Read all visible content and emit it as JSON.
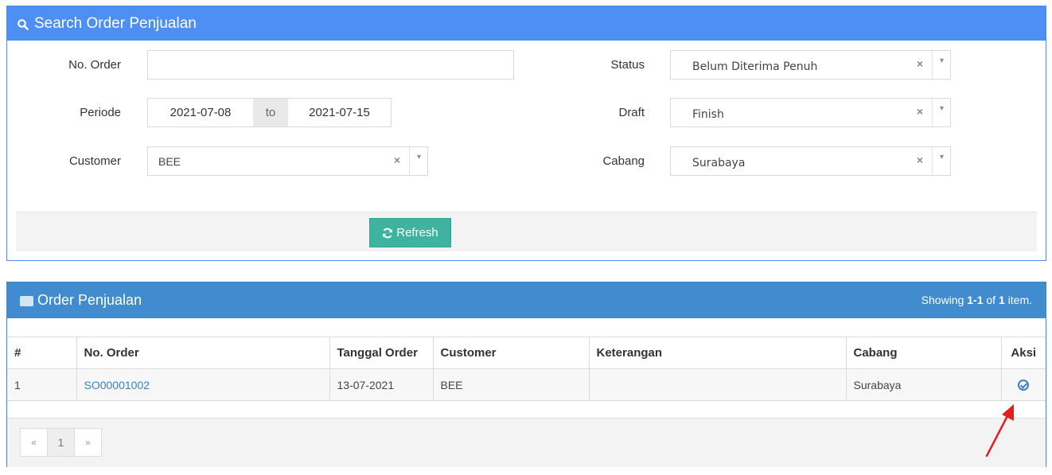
{
  "search": {
    "title": "Search Order Penjualan",
    "no_order_label": "No. Order",
    "no_order_value": "",
    "periode_label": "Periode",
    "periode_from": "2021-07-08",
    "periode_to_label": "to",
    "periode_to": "2021-07-15",
    "customer_label": "Customer",
    "customer_value": "BEE",
    "status_label": "Status",
    "status_value": "Belum Diterima Penuh",
    "draft_label": "Draft",
    "draft_value": "Finish",
    "cabang_label": "Cabang",
    "cabang_value": "Surabaya",
    "clear_glyph": "×",
    "arrow_glyph": "▾",
    "refresh_label": "Refresh",
    "refresh_icon": "refresh-icon"
  },
  "grid": {
    "title": "Order Penjualan",
    "summary_prefix": "Showing ",
    "summary_range": "1-1",
    "summary_of": " of ",
    "summary_total": "1",
    "summary_suffix": " item.",
    "columns": [
      "#",
      "No. Order",
      "Tanggal Order",
      "Customer",
      "Keterangan",
      "Cabang",
      "Aksi"
    ],
    "rows": [
      {
        "no": "1",
        "order": "SO00001002",
        "tanggal": "13-07-2021",
        "customer": "BEE",
        "keterangan": "",
        "cabang": "Surabaya",
        "aksi_icon": "check-circle-icon"
      }
    ],
    "pager": {
      "prev": "«",
      "page": "1",
      "next": "»"
    }
  },
  "colors": {
    "search_header": "#4d8ff3",
    "grid_header": "#418bcf",
    "refresh_button": "#3eb39f",
    "link": "#3a7fc1",
    "annotation_arrow": "#e02020"
  }
}
